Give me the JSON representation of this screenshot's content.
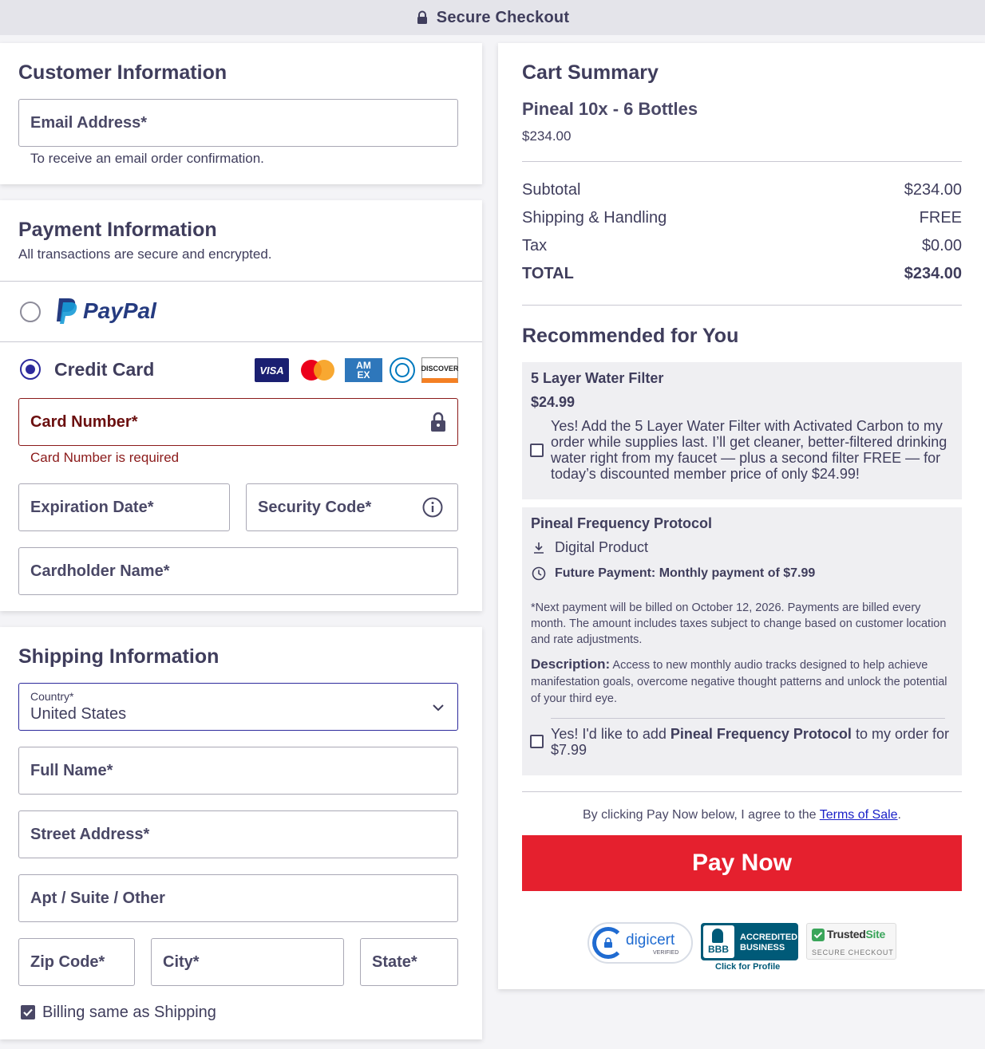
{
  "header": {
    "title": "Secure Checkout"
  },
  "customer": {
    "heading": "Customer Information",
    "email_label": "Email Address*",
    "email_hint": "To receive an email order confirmation."
  },
  "payment": {
    "heading": "Payment Information",
    "subtitle": "All transactions are secure and encrypted.",
    "paypal_label": "PayPal",
    "credit_card_label": "Credit Card",
    "card_logos": [
      "VISA",
      "Mastercard",
      "AMEX",
      "Diners Club",
      "DISCOVER"
    ],
    "card_number_label": "Card Number*",
    "card_number_error": "Card Number is required",
    "expiration_label": "Expiration Date*",
    "security_code_label": "Security Code*",
    "cardholder_label": "Cardholder Name*"
  },
  "shipping": {
    "heading": "Shipping Information",
    "country_label": "Country*",
    "country_value": "United States",
    "full_name_label": "Full Name*",
    "street_label": "Street Address*",
    "apt_label": "Apt / Suite / Other",
    "zip_label": "Zip Code*",
    "city_label": "City*",
    "state_label": "State*",
    "billing_same_label": "Billing same as Shipping",
    "billing_same_checked": true
  },
  "cart": {
    "heading": "Cart Summary",
    "product_name": "Pineal 10x - 6 Bottles",
    "product_price": "$234.00",
    "subtotal_label": "Subtotal",
    "subtotal_value": "$234.00",
    "shipping_label": "Shipping & Handling",
    "shipping_value": "FREE",
    "tax_label": "Tax",
    "tax_value": "$0.00",
    "total_label": "TOTAL",
    "total_value": "$234.00"
  },
  "recommended": {
    "heading": "Recommended for You",
    "item1": {
      "title": "5 Layer Water Filter",
      "price": "$24.99",
      "offer_text": "Yes! Add the 5 Layer Water Filter with Activated Carbon to my order while supplies last. I’ll get cleaner, better-filtered drinking water right from my faucet — plus a second filter FREE — for today’s discounted member price of only $24.99!"
    },
    "item2": {
      "title": "Pineal Frequency Protocol",
      "digital_label": "Digital Product",
      "future_payment": "Future Payment: Monthly payment of $7.99",
      "billing_note": "*Next payment will be billed on October 12, 2026. Payments are billed every month. The amount includes taxes subject to change based on customer location and rate adjustments.",
      "description_label": "Description:",
      "description_text": "Access to new monthly audio tracks designed to help achieve manifestation goals, overcome negative thought patterns and unlock the potential of your third eye.",
      "offer_prefix": "Yes! I'd like to add ",
      "offer_bold": "Pineal Frequency Protocol",
      "offer_suffix": " to my order for $7.99"
    }
  },
  "terms": {
    "prefix": "By clicking Pay Now below, I agree to the ",
    "link": "Terms of Sale",
    "suffix": "."
  },
  "pay_button": "Pay Now",
  "badges": {
    "digicert": "digicert",
    "digicert_sub": "VERIFIED",
    "bbb_line1": "ACCREDITED",
    "bbb_line2": "BUSINESS",
    "bbb_logo": "BBB",
    "bbb_profile": "Click for Profile",
    "trusted_a": "Trusted",
    "trusted_b": "Site",
    "trusted_sub": "SECURE CHECKOUT"
  },
  "colors": {
    "accent": "#2d2a9c",
    "text": "#3f3d5c",
    "error": "#8b1a1a",
    "pay_button": "#e5202e",
    "rec_background": "#efeff2"
  }
}
